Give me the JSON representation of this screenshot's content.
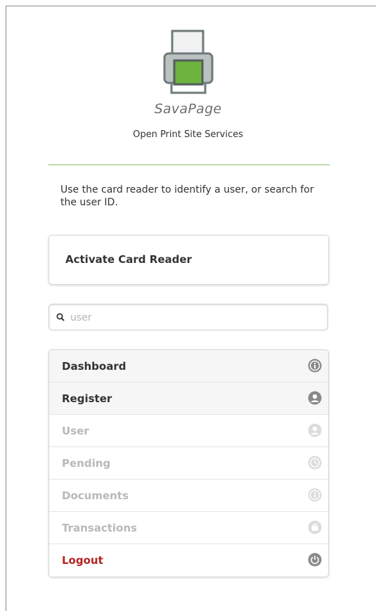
{
  "app": {
    "brand": "SavaPage",
    "tagline": "Open Print Site Services"
  },
  "instruction": "Use the card reader to identify a user, or search for the user ID.",
  "card_reader_button": "Activate Card Reader",
  "search": {
    "placeholder": "user",
    "value": ""
  },
  "menu": {
    "items": [
      {
        "label": "Dashboard",
        "icon": "info-icon",
        "enabled": true
      },
      {
        "label": "Register",
        "icon": "user-icon",
        "enabled": true
      },
      {
        "label": "User",
        "icon": "user-icon",
        "enabled": false
      },
      {
        "label": "Pending",
        "icon": "clock-icon",
        "enabled": false
      },
      {
        "label": "Documents",
        "icon": "info-icon",
        "enabled": false
      },
      {
        "label": "Transactions",
        "icon": "shopping-bag-icon",
        "enabled": false
      },
      {
        "label": "Logout",
        "icon": "power-icon",
        "enabled": true
      }
    ]
  },
  "colors": {
    "accent_green": "#6cb33f",
    "divider_green": "#8dbb6b",
    "logout_red": "#b22222",
    "icon_enabled": "#8a8a8a",
    "icon_disabled": "#dcdcdc"
  }
}
